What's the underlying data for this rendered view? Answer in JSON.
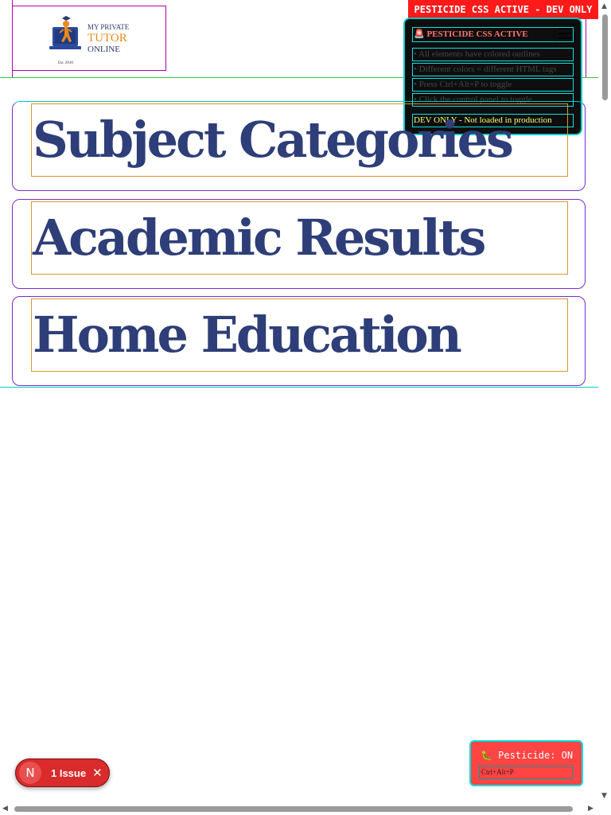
{
  "header": {
    "logo": {
      "line1": "MY PRIVATE",
      "line2": "TUTOR",
      "line3": "ONLINE",
      "est": "Est. 2010"
    },
    "menu_icon": "hamburger-icon"
  },
  "dev_banner": "PESTICIDE CSS ACTIVE - DEV ONLY",
  "info_panel": {
    "title": "🚨 PESTICIDE CSS ACTIVE",
    "items": [
      "• All elements have colored outlines",
      "• Different colors = different HTML tags",
      "• Press Ctrl+Alt+P to toggle",
      "• Click the control panel to toggle"
    ],
    "footer": "DEV ONLY - Not loaded in production"
  },
  "sections": [
    {
      "heading": "Subject Categories"
    },
    {
      "heading": "Academic Results"
    },
    {
      "heading": "Home Education"
    }
  ],
  "issues_badge": {
    "logo": "N",
    "label": "1 Issue",
    "close": "✕"
  },
  "pesticide_toggle": {
    "label": "🐛 Pesticide: ON",
    "shortcut": "Ctrl+Alt+P"
  },
  "colors": {
    "heading": "#2e3e78",
    "dev_banner": "#ff1a1a",
    "accent_outline": "#00cccc",
    "logo_orange": "#e88a1a"
  }
}
